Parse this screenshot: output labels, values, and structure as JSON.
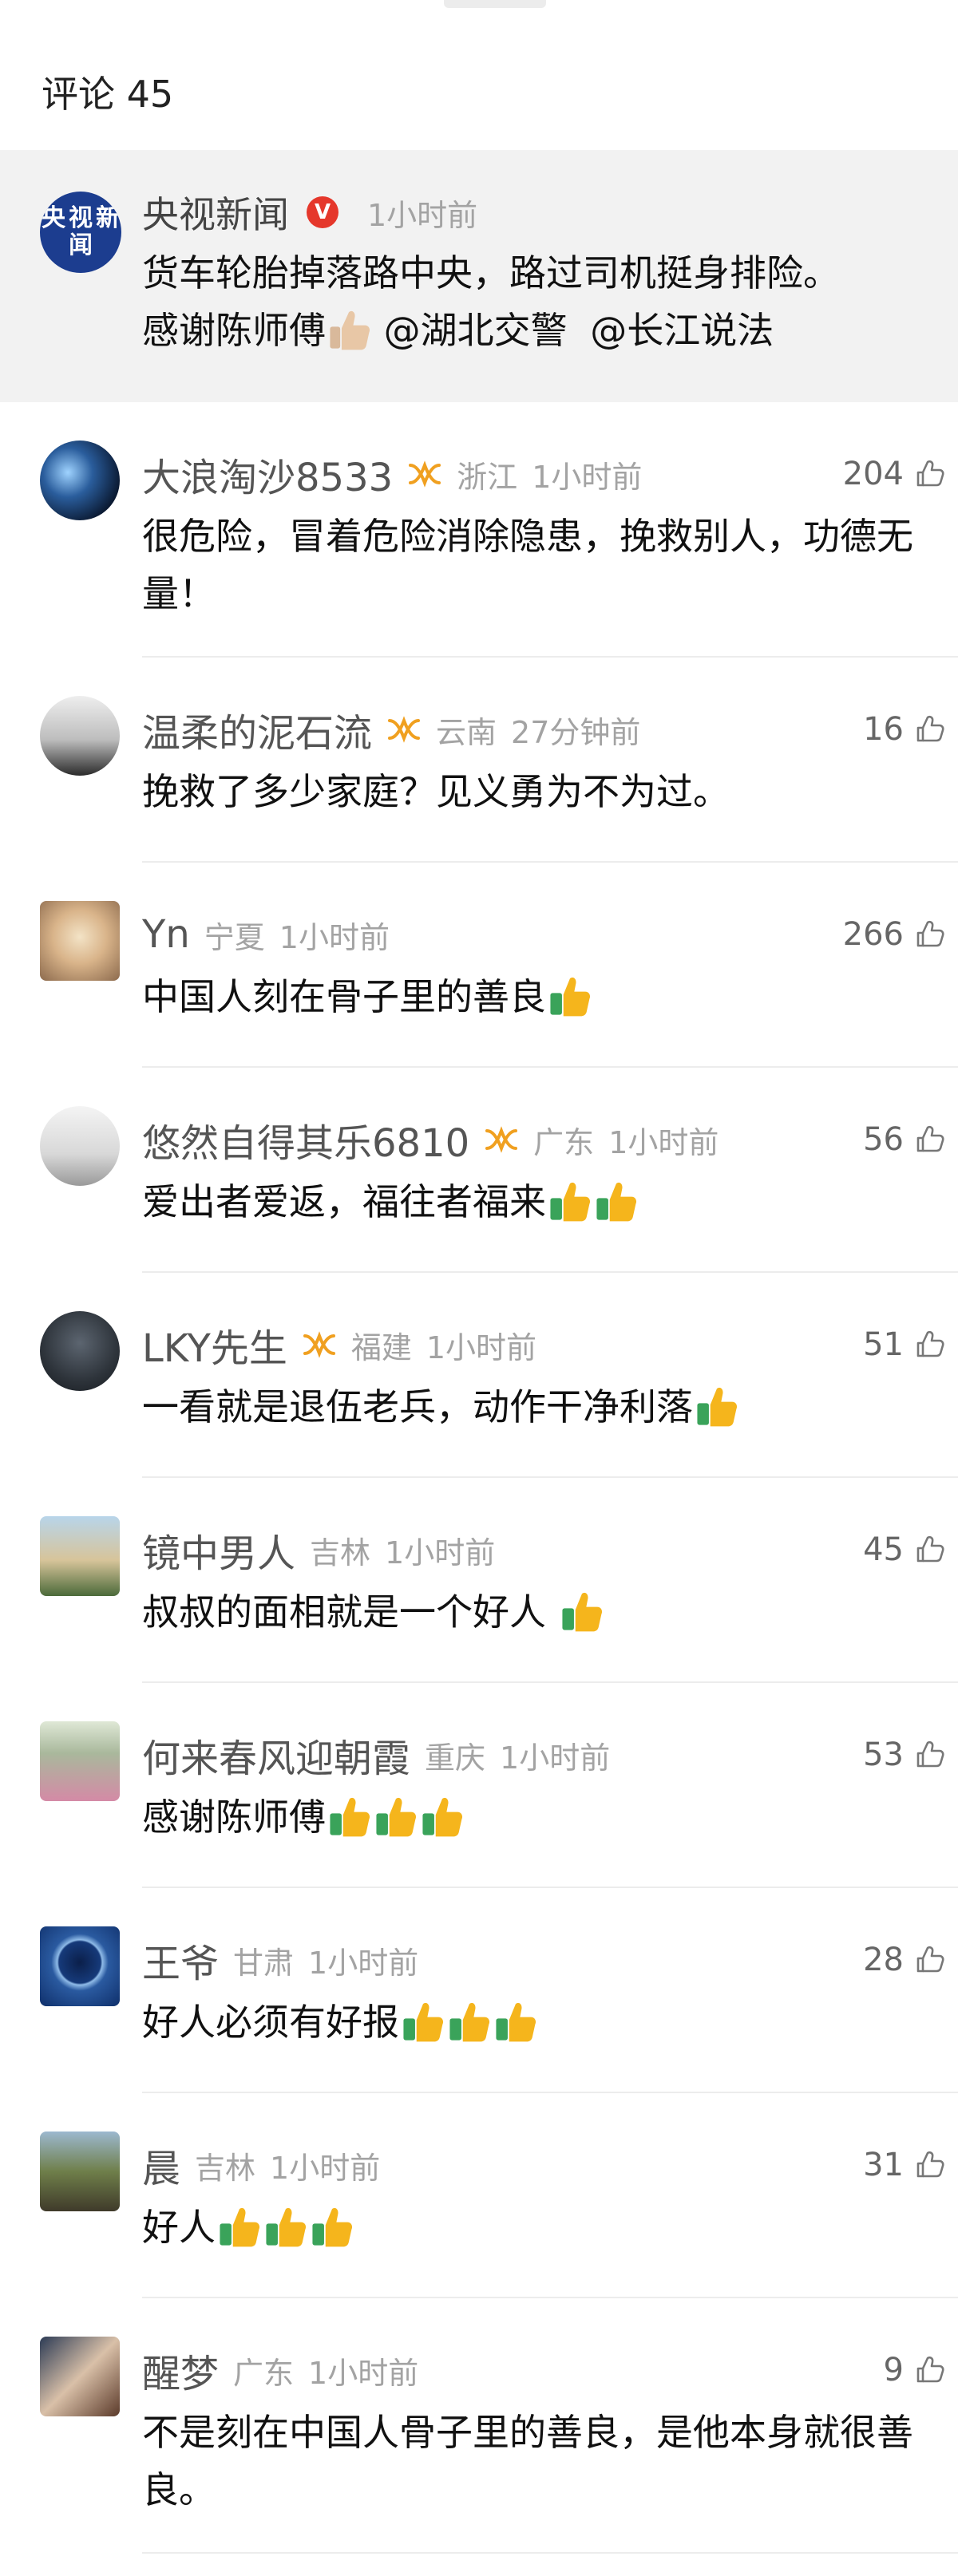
{
  "header": {
    "title": "评论 45"
  },
  "pinned": {
    "name": "央视新闻",
    "verified_icon": "verified-badge-icon",
    "verified_color": "#e5372b",
    "time": "1小时前",
    "avatar_text": [
      "央",
      "视",
      "新",
      "闻"
    ],
    "text_line1": "货车轮胎掉落路中央，路过司机挺身排险。",
    "text_line2": "感谢陈师傅",
    "mention1": "@湖北交警",
    "mention2": "@长江说法"
  },
  "comments": [
    {
      "name": "大浪淘沙8533",
      "member": true,
      "location": "浙江",
      "time": "1小时前",
      "likes": "204",
      "text": "很危险，冒着危险消除隐患，挽救别人，功德无量！",
      "thumbs": 0
    },
    {
      "name": "温柔的泥石流",
      "member": true,
      "location": "云南",
      "time": "27分钟前",
      "likes": "16",
      "text": "挽救了多少家庭？见义勇为不为过。",
      "thumbs": 0
    },
    {
      "name": "Yn",
      "member": false,
      "location": "宁夏",
      "time": "1小时前",
      "likes": "266",
      "text": "中国人刻在骨子里的善良",
      "thumbs": 1
    },
    {
      "name": "悠然自得其乐6810",
      "member": true,
      "location": "广东",
      "time": "1小时前",
      "likes": "56",
      "text": "爱出者爱返，福往者福来",
      "thumbs": 2
    },
    {
      "name": "LKY先生",
      "member": true,
      "location": "福建",
      "time": "1小时前",
      "likes": "51",
      "text": "一看就是退伍老兵，动作干净利落",
      "thumbs": 1
    },
    {
      "name": "镜中男人",
      "member": false,
      "location": "吉林",
      "time": "1小时前",
      "likes": "45",
      "text": "叔叔的面相就是一个好人 ",
      "thumbs": 1
    },
    {
      "name": "何来春风迎朝霞",
      "member": false,
      "location": "重庆",
      "time": "1小时前",
      "likes": "53",
      "text": "感谢陈师傅",
      "thumbs": 3
    },
    {
      "name": "王爷",
      "member": false,
      "location": "甘肃",
      "time": "1小时前",
      "likes": "28",
      "text": "好人必须有好报",
      "thumbs": 3
    },
    {
      "name": "晨",
      "member": false,
      "location": "吉林",
      "time": "1小时前",
      "likes": "31",
      "text": "好人",
      "thumbs": 3
    },
    {
      "name": "醒梦",
      "member": false,
      "location": "广东",
      "time": "1小时前",
      "likes": "9",
      "text": "不是刻在中国人骨子里的善良，是他本身就很善良。",
      "thumbs": 0
    }
  ],
  "icons": {
    "like": "thumbs-up-outline-icon",
    "member": "membership-badge-icon",
    "emoji": "thumbs-up-emoji-icon"
  },
  "colors": {
    "pinned_bg": "#f2f2f2",
    "meta_gray": "#a3a3a3",
    "member_gold": "#f0a020",
    "emoji_green": "#3aa35a",
    "emoji_yellow": "#f5b51c"
  }
}
